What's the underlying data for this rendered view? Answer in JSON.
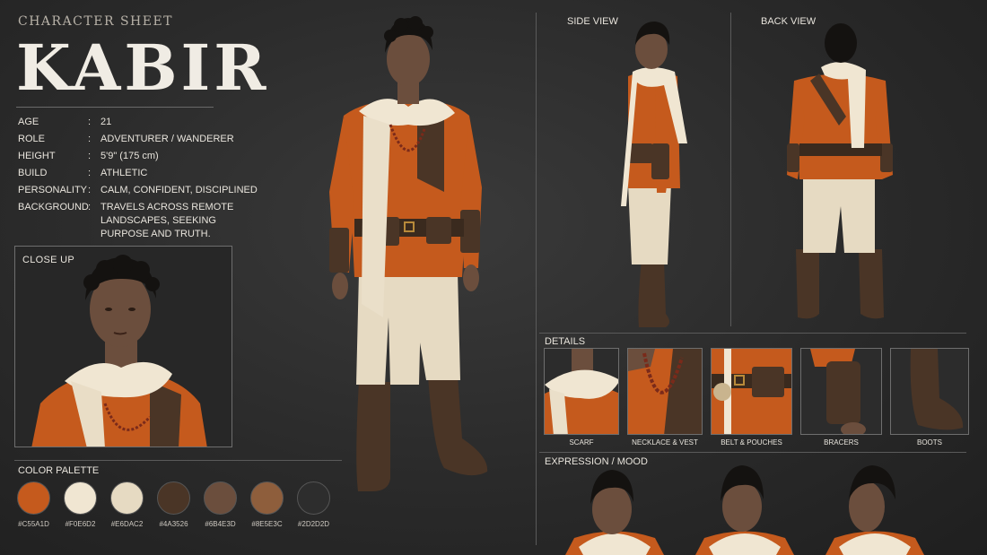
{
  "header": {
    "label": "CHARACTER SHEET",
    "name": "KABIR"
  },
  "stats": [
    {
      "key": "AGE",
      "value": "21"
    },
    {
      "key": "ROLE",
      "value": "ADVENTURER / WANDERER"
    },
    {
      "key": "HEIGHT",
      "value": "5'9\" (175 cm)"
    },
    {
      "key": "BUILD",
      "value": "ATHLETIC"
    },
    {
      "key": "PERSONALITY",
      "value": "CALM, CONFIDENT, DISCIPLINED"
    },
    {
      "key": "BACKGROUND",
      "value": "TRAVELS ACROSS REMOTE LANDSCAPES, SEEKING PURPOSE AND TRUTH."
    }
  ],
  "closeup": {
    "label": "CLOSE UP"
  },
  "palette": {
    "title": "COLOR PALETTE",
    "colors": [
      "#C55A1D",
      "#F0E6D2",
      "#E6DAC2",
      "#4A3526",
      "#6B4E3D",
      "#8E5E3C",
      "#2D2D2D"
    ]
  },
  "views": {
    "side": "SIDE VIEW",
    "back": "BACK VIEW"
  },
  "details": {
    "title": "DETAILS",
    "items": [
      "SCARF",
      "NECKLACE & VEST",
      "BELT & POUCHES",
      "BRACERS",
      "BOOTS"
    ]
  },
  "expression": {
    "title": "EXPRESSION / MOOD"
  },
  "colors": {
    "tunic": "#C55A1D",
    "scarf": "#F0E6D2",
    "pants": "#E6DAC2",
    "leather": "#4A3526",
    "skin": "#6B4E3D",
    "hair": "#141210",
    "beads": "#7a2a1a"
  }
}
